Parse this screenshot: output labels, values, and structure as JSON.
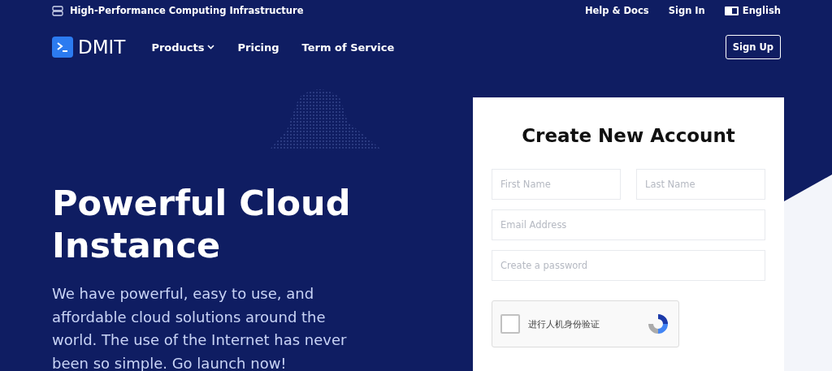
{
  "top_bar": {
    "tagline": "High-Performance Computing Infrastructure",
    "links": [
      "Help & Docs",
      "Sign In"
    ],
    "language": "English"
  },
  "nav": {
    "logo": "DMIT",
    "items": [
      {
        "label": "Products",
        "dropdown": true
      },
      {
        "label": "Pricing",
        "dropdown": false
      },
      {
        "label": "Term of Service",
        "dropdown": false
      }
    ],
    "signup": "Sign Up"
  },
  "hero": {
    "title": "Powerful Cloud Instance",
    "description": "We have powerful, easy to use, and affordable cloud solutions around the world. The use of the Internet has never been so simple. Go launch now!"
  },
  "form": {
    "title": "Create New Account",
    "name_fields": [
      {
        "placeholder": "First Name"
      },
      {
        "placeholder": "Last Name"
      }
    ],
    "fields": [
      {
        "placeholder": "Email Address"
      },
      {
        "placeholder": "Create a password"
      }
    ],
    "captcha": {
      "label": "进行人机身份验证",
      "checked": false
    }
  }
}
